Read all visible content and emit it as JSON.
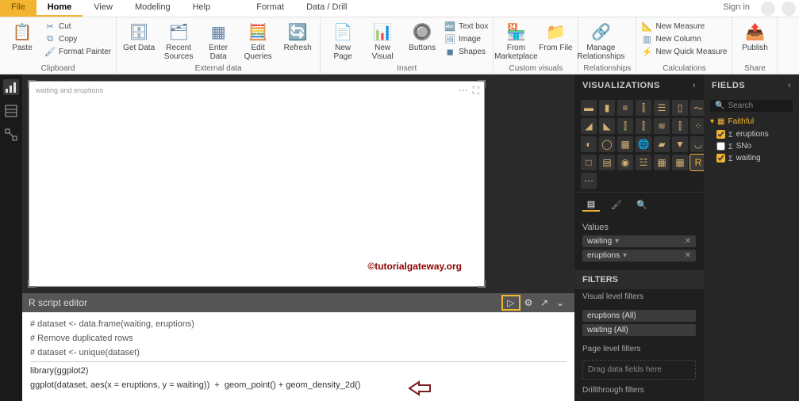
{
  "topbar": {
    "file": "File",
    "home": "Home",
    "view": "View",
    "modeling": "Modeling",
    "help": "Help",
    "format": "Format",
    "datadrill": "Data / Drill",
    "signin": "Sign in"
  },
  "ribbon": {
    "clipboard": {
      "label": "Clipboard",
      "paste": "Paste",
      "cut": "Cut",
      "copy": "Copy",
      "fmtpainter": "Format Painter"
    },
    "external": {
      "label": "External data",
      "getdata": "Get\nData",
      "recent": "Recent\nSources",
      "enter": "Enter\nData",
      "edit": "Edit\nQueries",
      "refresh": "Refresh"
    },
    "insert": {
      "label": "Insert",
      "newpage": "New\nPage",
      "newvisual": "New\nVisual",
      "buttons": "Buttons",
      "textbox": "Text box",
      "image": "Image",
      "shapes": "Shapes"
    },
    "custom": {
      "label": "Custom visuals",
      "marketplace": "From\nMarketplace",
      "file": "From\nFile"
    },
    "relationships": {
      "label": "Relationships",
      "manage": "Manage\nRelationships"
    },
    "calculations": {
      "label": "Calculations",
      "measure": "New Measure",
      "column": "New Column",
      "quick": "New Quick Measure"
    },
    "share": {
      "label": "Share",
      "publish": "Publish"
    }
  },
  "canvas": {
    "title": "waiting and eruptions",
    "watermark": "©tutorialgateway.org"
  },
  "script": {
    "title": "R script editor",
    "l1": "# dataset <- data.frame(waiting, eruptions)",
    "l2": "",
    "l3": "# Remove duplicated rows",
    "l4": "# dataset <- unique(dataset)",
    "l5": "library(ggplot2)",
    "l6": "",
    "l7": "ggplot(dataset, aes(x = eruptions, y = waiting))  +  geom_point() + geom_density_2d()"
  },
  "viz": {
    "header": "VISUALIZATIONS",
    "values": "Values",
    "field_waiting": "waiting",
    "field_eruptions": "eruptions",
    "filters": "FILTERS",
    "visualfilters": "Visual level filters",
    "f_eruptions": "eruptions  (All)",
    "f_waiting": "waiting  (All)",
    "pagefilters": "Page level filters",
    "dragzone": "Drag data fields here",
    "drill": "Drillthrough filters"
  },
  "fields": {
    "header": "FIELDS",
    "search": "Search",
    "table": "Faithful",
    "eruptions": "eruptions",
    "sno": "SNo",
    "waiting": "waiting"
  }
}
